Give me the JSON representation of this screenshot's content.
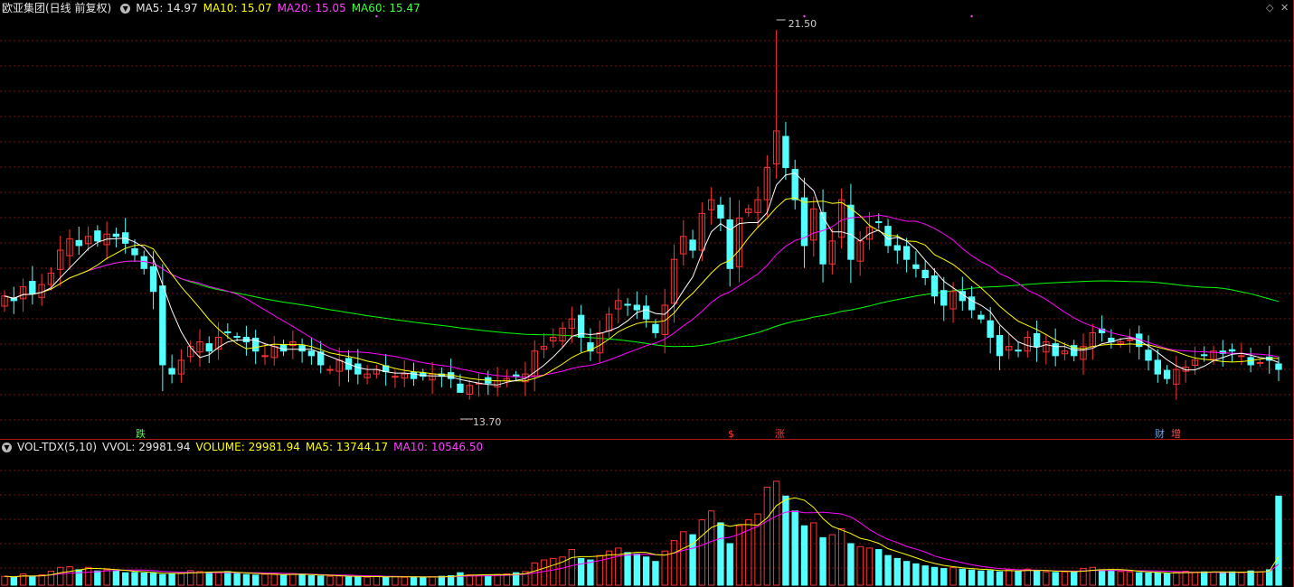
{
  "header": {
    "stock_name": "欧亚集团(日线 前复权)",
    "ma5": "MA5: 14.97",
    "ma10": "MA10: 15.07",
    "ma20": "MA20: 15.05",
    "ma60": "MA60: 15.47"
  },
  "volume_header": {
    "indicator": "VOL-TDX(5,10)",
    "vvol": "VVOL: 29981.94",
    "volume": "VOLUME: 29981.94",
    "ma5": "MA5: 13744.17",
    "ma10": "MA10: 10546.50"
  },
  "markers": {
    "high_label": "21.50",
    "low_label": "13.70",
    "event_fall": "跌",
    "event_dollar": "$",
    "event_rise": "涨",
    "event_fin": "财",
    "event_add": "增"
  },
  "colors": {
    "up": "#ff3232",
    "down": "#54ffff",
    "ma5": "#ffffff",
    "ma10": "#ffff00",
    "ma20": "#ff00ff",
    "ma60": "#00ff00",
    "grid": "#7a1010",
    "separator": "#aa1515"
  },
  "chart_data": {
    "type": "candlestick",
    "title": "欧亚集团(日线 前复权)",
    "ylim": [
      12.9,
      21.8
    ],
    "volume_ylim": [
      0,
      45000
    ],
    "series": [
      {
        "name": "MA5",
        "last": 14.97
      },
      {
        "name": "MA10",
        "last": 15.07
      },
      {
        "name": "MA20",
        "last": 15.05
      },
      {
        "name": "MA60",
        "last": 15.47
      }
    ],
    "close": [
      15.7,
      15.6,
      15.9,
      15.75,
      15.95,
      16.2,
      16.7,
      16.95,
      16.8,
      17.0,
      16.9,
      17.05,
      17.0,
      16.85,
      16.6,
      16.3,
      15.8,
      14.2,
      14.0,
      14.3,
      14.6,
      14.7,
      14.5,
      14.8,
      14.9,
      14.8,
      14.7,
      14.5,
      14.4,
      14.6,
      14.5,
      14.7,
      14.5,
      14.4,
      14.2,
      14.1,
      14.3,
      14.1,
      14.0,
      14.0,
      14.1,
      14.05,
      13.95,
      14.0,
      13.9,
      13.95,
      14.0,
      13.95,
      13.9,
      13.6,
      13.75,
      13.8,
      13.8,
      13.85,
      13.9,
      13.95,
      14.0,
      14.5,
      14.6,
      14.8,
      15.0,
      15.2,
      14.8,
      14.5,
      14.9,
      15.3,
      15.6,
      15.5,
      15.4,
      15.2,
      14.9,
      15.5,
      16.5,
      17.0,
      16.7,
      17.5,
      17.8,
      17.4,
      16.3,
      17.4,
      17.6,
      17.8,
      18.5,
      19.3,
      18.5,
      17.8,
      16.8,
      17.6,
      16.4,
      16.9,
      17.8,
      16.5,
      16.9,
      17.2,
      17.3,
      16.8,
      16.7,
      16.5,
      16.3,
      16.1,
      15.7,
      15.5,
      15.8,
      15.6,
      15.4,
      15.2,
      14.8,
      14.4,
      14.6,
      14.5,
      14.8,
      14.6,
      14.7,
      14.4,
      14.5,
      14.4,
      14.6,
      14.9,
      14.9,
      14.7,
      14.7,
      14.75,
      14.6,
      14.3,
      14.0,
      13.9,
      14.1,
      14.15,
      14.3,
      14.4,
      14.5,
      14.45,
      14.5,
      14.4,
      14.2,
      14.25,
      14.3,
      14.1
    ],
    "volume": [
      3000,
      2600,
      3800,
      2900,
      3500,
      4700,
      6000,
      6200,
      5200,
      6000,
      4800,
      5200,
      4900,
      4200,
      4300,
      4100,
      4000,
      3600,
      3900,
      4200,
      4900,
      4600,
      4400,
      4200,
      4600,
      3900,
      3600,
      3400,
      3700,
      3800,
      3500,
      3900,
      3500,
      3200,
      3100,
      3000,
      3100,
      2800,
      2900,
      2700,
      2900,
      2800,
      2900,
      2700,
      2800,
      2700,
      2800,
      3000,
      3200,
      4200,
      3500,
      3400,
      3300,
      3600,
      3800,
      4200,
      4600,
      7500,
      8500,
      9000,
      9500,
      12000,
      9000,
      8500,
      10000,
      11500,
      12500,
      11000,
      10500,
      9500,
      8000,
      11500,
      15000,
      18000,
      17000,
      22000,
      25000,
      21000,
      14000,
      20000,
      22000,
      24000,
      33000,
      35000,
      30000,
      25000,
      20000,
      21000,
      16000,
      17000,
      19000,
      14000,
      13000,
      12500,
      12000,
      10000,
      9000,
      8000,
      7200,
      6500,
      6000,
      5600,
      5900,
      5400,
      5100,
      4800,
      4900,
      4500,
      5200,
      4700,
      5400,
      4800,
      4500,
      4300,
      4500,
      4700,
      5600,
      6000,
      5200,
      4900,
      4600,
      4500,
      4200,
      4100,
      4200,
      3900,
      4300,
      4700,
      4400,
      4500,
      4400,
      4300,
      4500,
      4200,
      4800,
      4500,
      5200,
      29981.94
    ]
  }
}
